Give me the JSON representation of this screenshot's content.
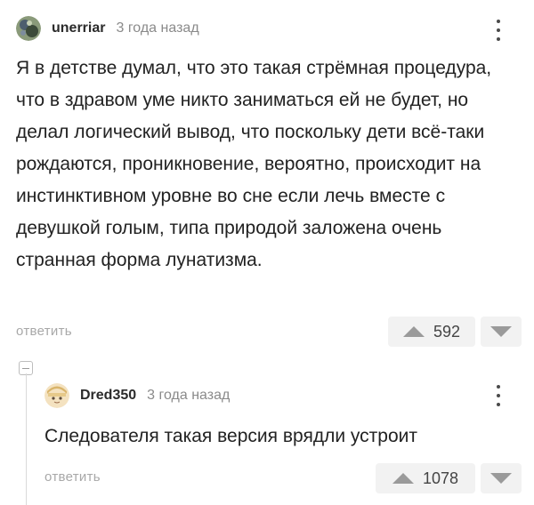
{
  "comments": [
    {
      "username": "unerriar",
      "time": "3 года назад",
      "text": "Я в детстве думал, что это такая стрёмная процедура, что в здравом уме никто заниматься ей не будет, но делал логический вывод, что поскольку дети всё-таки рождаются, проникновение, вероятно, происходит на инстинктивном уровне во сне если лечь вместе с девушкой голым, типа природой заложена очень странная форма лунатизма.",
      "reply_label": "ответить",
      "rating": "592",
      "avatar_icon": "abstract-avatar-icon"
    },
    {
      "username": "Dred350",
      "time": "3 года назад",
      "text": "Следователя такая версия врядли устроит",
      "reply_label": "ответить",
      "rating": "1078",
      "avatar_icon": "anime-avatar-icon"
    }
  ],
  "colors": {
    "muted_text": "#a8a8a8",
    "vote_bg": "#f2f2f2",
    "vote_arrow": "#9a9a9a"
  }
}
